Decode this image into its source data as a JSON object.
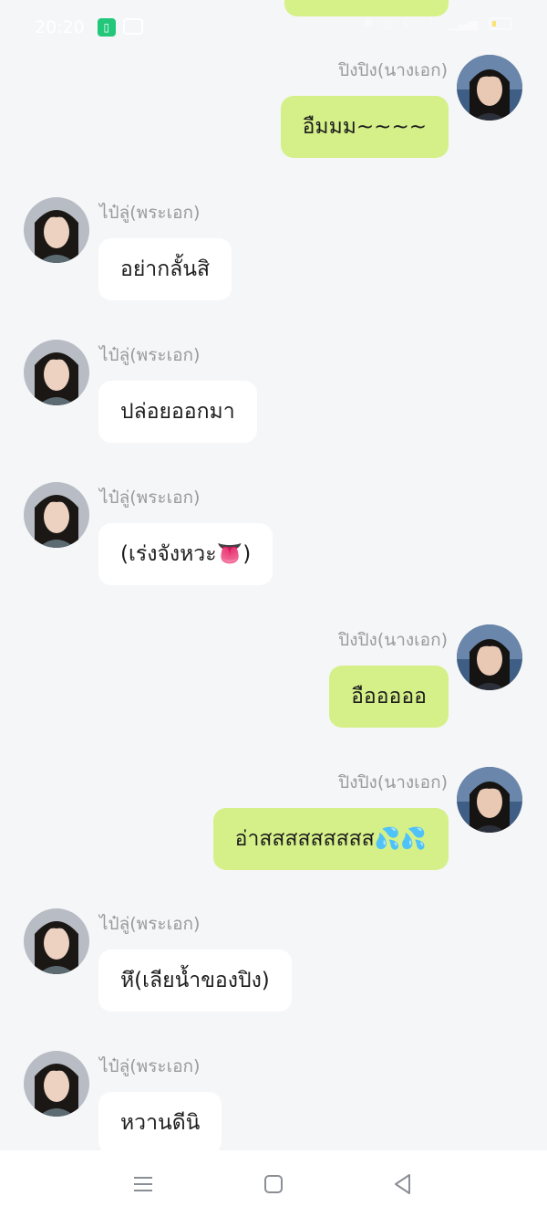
{
  "status_bar": {
    "time": "20:20",
    "icons_left": [
      "app-icon",
      "video-icon"
    ],
    "icons_right": [
      "bluetooth-icon",
      "vibrate-icon",
      "moon-icon",
      "wifi-icon",
      "signal-icon",
      "battery-icon"
    ]
  },
  "messages": [
    {
      "side": "right",
      "sender": "ปิงปิง(นางเอก)",
      "text": "อืมมม~~~~"
    },
    {
      "side": "left",
      "sender": "ไป๋ลู่(พระเอก)",
      "text": "อย่ากลั้นสิ"
    },
    {
      "side": "left",
      "sender": "ไป๋ลู่(พระเอก)",
      "text": "ปล่อยออกมา"
    },
    {
      "side": "left",
      "sender": "ไป๋ลู่(พระเอก)",
      "text": "(เร่งจังหวะ👅)"
    },
    {
      "side": "right",
      "sender": "ปิงปิง(นางเอก)",
      "text": "อือออออ"
    },
    {
      "side": "right",
      "sender": "ปิงปิง(นางเอก)",
      "text": "อ่าสสสสสสสสส💦💦"
    },
    {
      "side": "left",
      "sender": "ไป๋ลู่(พระเอก)",
      "text": "หึ(เลียน้ำของปิง)"
    },
    {
      "side": "left",
      "sender": "ไป๋ลู่(พระเอก)",
      "text": "หวานดีนิ"
    }
  ],
  "nav": {
    "icons": [
      "menu-icon",
      "home-icon",
      "back-icon"
    ]
  }
}
